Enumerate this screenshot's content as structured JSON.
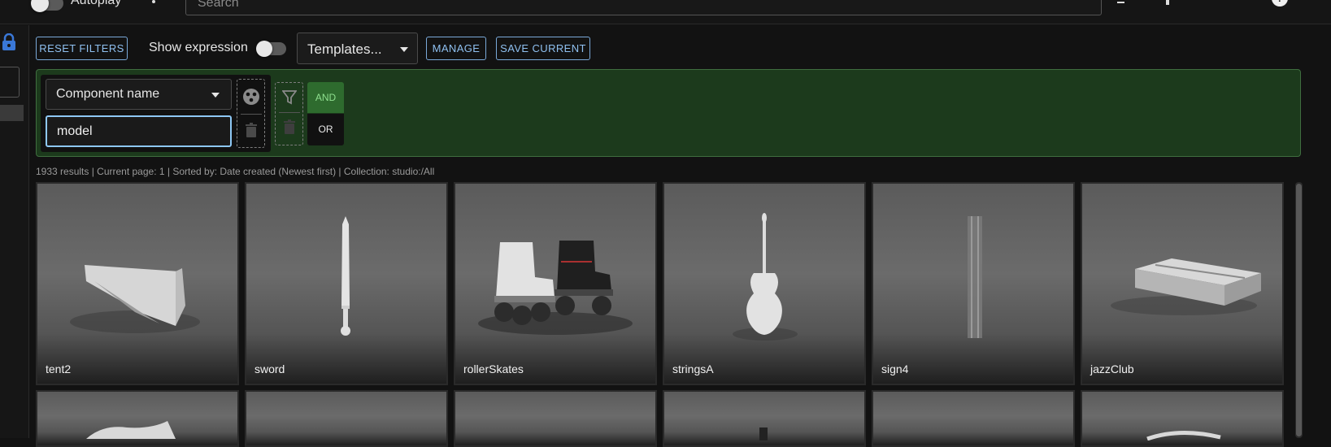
{
  "topbar": {
    "autoplay_label": "Autoplay",
    "search_placeholder": "Search"
  },
  "toolbar": {
    "reset_label": "RESET FILTERS",
    "show_expression_label": "Show expression",
    "templates_label": "Templates...",
    "manage_label": "MANAGE",
    "save_current_label": "SAVE CURRENT"
  },
  "filter": {
    "field_label": "Component name",
    "value": "model",
    "and_label": "AND",
    "or_label": "OR"
  },
  "status_text": "1933 results | Current page: 1 | Sorted by: Date created (Newest first) | Collection: studio:/All",
  "results": [
    {
      "name": "tent2"
    },
    {
      "name": "sword"
    },
    {
      "name": "rollerSkates"
    },
    {
      "name": "stringsA"
    },
    {
      "name": "sign4"
    },
    {
      "name": "jazzClub"
    }
  ],
  "colors": {
    "accent": "#8fc0f0",
    "filter_bg": "#1c3a1c",
    "and_active": "#2e6b2e"
  }
}
